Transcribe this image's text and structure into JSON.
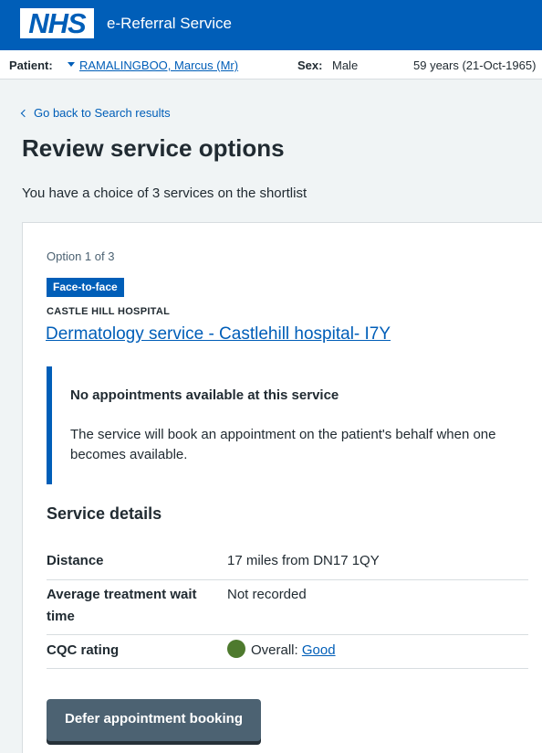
{
  "header": {
    "logo_text": "NHS",
    "service_name": "e-Referral Service",
    "brand_color": "#005eb8"
  },
  "patient_bar": {
    "patient_label": "Patient:",
    "patient_name": "RAMALINGBOO, Marcus (Mr)",
    "sex_label": "Sex:",
    "sex_value": "Male",
    "age": "59 years (21-Oct-1965)"
  },
  "navigation": {
    "back_link": "Go back to Search results"
  },
  "page": {
    "title": "Review service options",
    "shortlist_text": "You have a choice of 3 services on the shortlist"
  },
  "option": {
    "label": "Option 1 of 3",
    "tag": "Face-to-face",
    "hospital": "CASTLE HILL HOSPITAL",
    "service_link": "Dermatology service - Castlehill hospital- I7Y",
    "inset_title": "No appointments available at this service",
    "inset_body": "The service will book an appointment on the patient's behalf when one becomes available.",
    "details_heading": "Service details",
    "details": [
      {
        "key": "Distance",
        "value": "17 miles from DN17 1QY"
      },
      {
        "key": "Average treatment wait time",
        "value": "Not recorded"
      },
      {
        "key": "CQC rating",
        "value_prefix": "Overall:",
        "value_link": "Good",
        "status_color": "#4e7a2e"
      }
    ],
    "defer_button": "Defer appointment booking"
  }
}
